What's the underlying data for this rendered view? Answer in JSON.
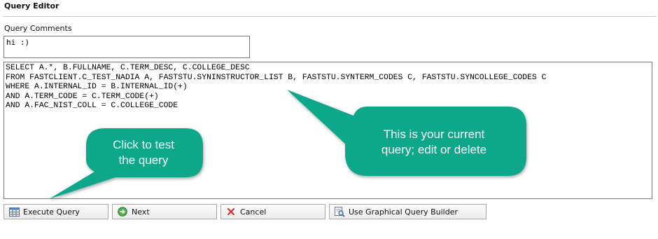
{
  "section_title": "Query Editor",
  "comments": {
    "label": "Query Comments",
    "value": "hi :)"
  },
  "query": {
    "lines": [
      "SELECT A.*, B.FULLNAME, C.TERM_DESC, C.COLLEGE_DESC",
      "FROM FASTCLIENT.C_TEST_NADIA A, FASTSTU.SYNINSTRUCTOR_LIST B, FASTSTU.SYNTERM_CODES C, FASTSTU.SYNCOLLEGE_CODES C",
      "WHERE A.INTERNAL_ID = B.INTERNAL_ID(+)",
      "AND A.TERM_CODE = C.TERM_CODE(+)",
      "AND A.FAC_NIST_COLL = C.COLLEGE_CODE"
    ]
  },
  "buttons": {
    "execute": "Execute Query",
    "next": "Next",
    "cancel": "Cancel",
    "builder": "Use Graphical Query Builder"
  },
  "callouts": {
    "test_line1": "Click to test",
    "test_line2": "the query",
    "query_line1": "This is your current",
    "query_line2": "query; edit or delete",
    "color": "#0ea88a"
  },
  "icons": {
    "execute": "table-icon",
    "next": "next-arrow-icon",
    "cancel": "cancel-x-icon",
    "builder": "query-builder-icon"
  }
}
